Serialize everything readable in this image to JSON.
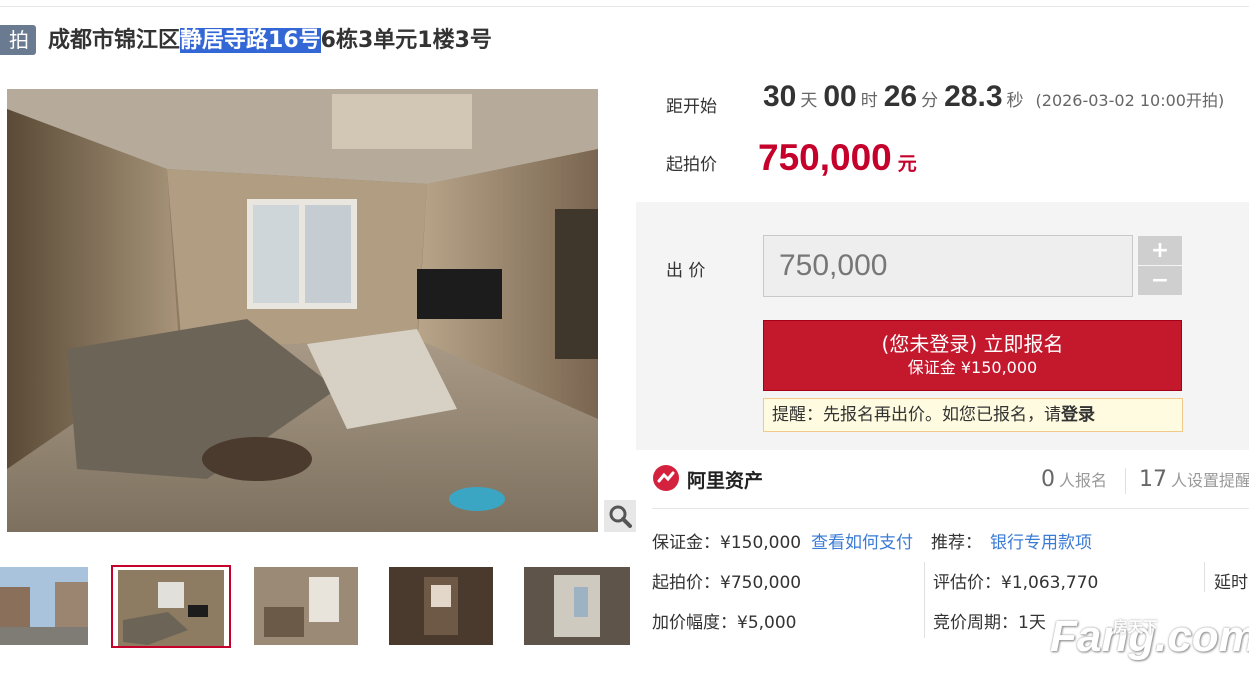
{
  "header": {
    "badge": "拍",
    "title_prefix": "成都市锦江区",
    "title_highlight": "静居寺路16号",
    "title_suffix": "6栋3单元1楼3号"
  },
  "countdown": {
    "label": "距开始",
    "days": "30",
    "days_unit": "天",
    "hours": "00",
    "hours_unit": "时",
    "minutes": "26",
    "minutes_unit": "分",
    "seconds": "28.3",
    "seconds_unit": "秒",
    "start_date": "(2026-03-02 10:00开拍)"
  },
  "start_price": {
    "label": "起拍价",
    "value": "750,000",
    "unit": "元"
  },
  "bid": {
    "label": "出 价",
    "input_value": "750,000",
    "plus": "+",
    "minus": "−",
    "signup_line1": "(您未登录) 立即报名",
    "signup_line2": "保证金 ¥150,000",
    "tip_text": "提醒：先报名再出价。如您已报名，请",
    "tip_login": "登录"
  },
  "platform": {
    "name": "阿里资产",
    "signups": "0",
    "signups_label": "人报名",
    "reminders": "17",
    "reminders_label": "人设置提醒"
  },
  "details": {
    "deposit": "保证金：¥150,000",
    "how_to_pay": "查看如何支付",
    "recommend_label": "推荐：",
    "recommend_value": "银行专用款项",
    "start_price": "起拍价：¥750,000",
    "appraisal": "评估价：¥1,063,770",
    "delay": "延时",
    "increment": "加价幅度：¥5,000",
    "period": "竞价周期：1天"
  },
  "watermark": {
    "big": "Fang.com",
    "small": "房天下"
  },
  "colors": {
    "accent": "#c4182d",
    "link": "#3a7bd5",
    "highlight": "#3367d6"
  }
}
